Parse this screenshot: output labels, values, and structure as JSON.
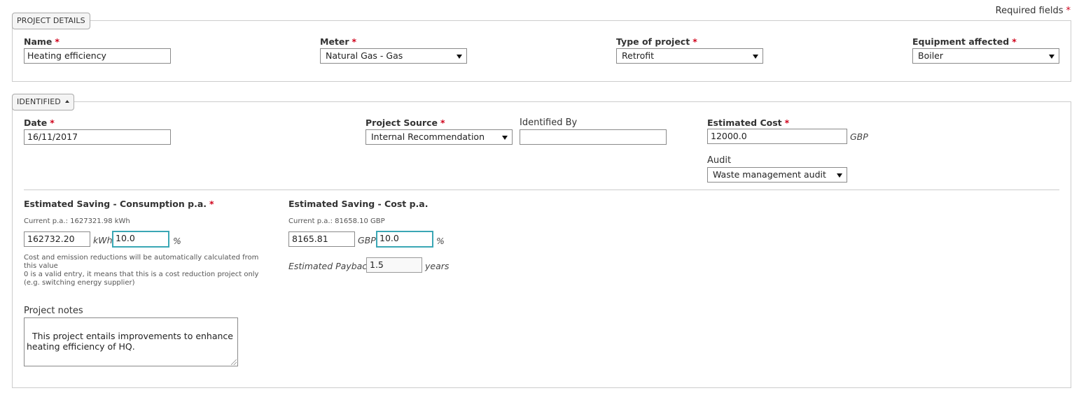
{
  "required_note": "Required fields",
  "required_marker": "*",
  "project_details": {
    "legend": "PROJECT DETAILS",
    "name": {
      "label": "Name",
      "value": "Heating efficiency"
    },
    "meter": {
      "label": "Meter",
      "value": "Natural Gas - Gas"
    },
    "type_of_project": {
      "label": "Type of project",
      "value": "Retrofit"
    },
    "equipment_affected": {
      "label": "Equipment affected",
      "value": "Boiler"
    }
  },
  "identified": {
    "legend": "IDENTIFIED",
    "date": {
      "label": "Date",
      "value": "16/11/2017"
    },
    "project_source": {
      "label": "Project Source",
      "value": "Internal Recommendation"
    },
    "identified_by": {
      "label": "Identified By",
      "value": ""
    },
    "estimated_cost": {
      "label": "Estimated Cost",
      "value": "12000.0",
      "unit": "GBP"
    },
    "audit": {
      "label": "Audit",
      "value": "Waste management audit"
    },
    "saving_consumption": {
      "label": "Estimated Saving - Consumption p.a.",
      "current": "Current p.a.: 1627321.98 kWh",
      "value": "162732.20",
      "unit": "kWh",
      "percent": "10.0",
      "percent_unit": "%",
      "help_line1": "Cost and emission reductions will be automatically calculated from this value",
      "help_line2": "0 is a valid entry, it means that this is a cost reduction project only (e.g. switching energy supplier)"
    },
    "saving_cost": {
      "label": "Estimated Saving - Cost p.a.",
      "current": "Current p.a.: 81658.10 GBP",
      "value": "8165.81",
      "unit": "GBP",
      "percent": "10.0",
      "percent_unit": "%"
    },
    "payback": {
      "label": "Estimated Payback",
      "value": "1.5",
      "unit": "years"
    },
    "notes": {
      "label": "Project notes",
      "value": "This project entails improvements to enhance heating efficiency of HQ."
    }
  },
  "colors": {
    "required": "#d0021b",
    "focus_border": "#3aa7b5",
    "border": "#cccccc"
  }
}
